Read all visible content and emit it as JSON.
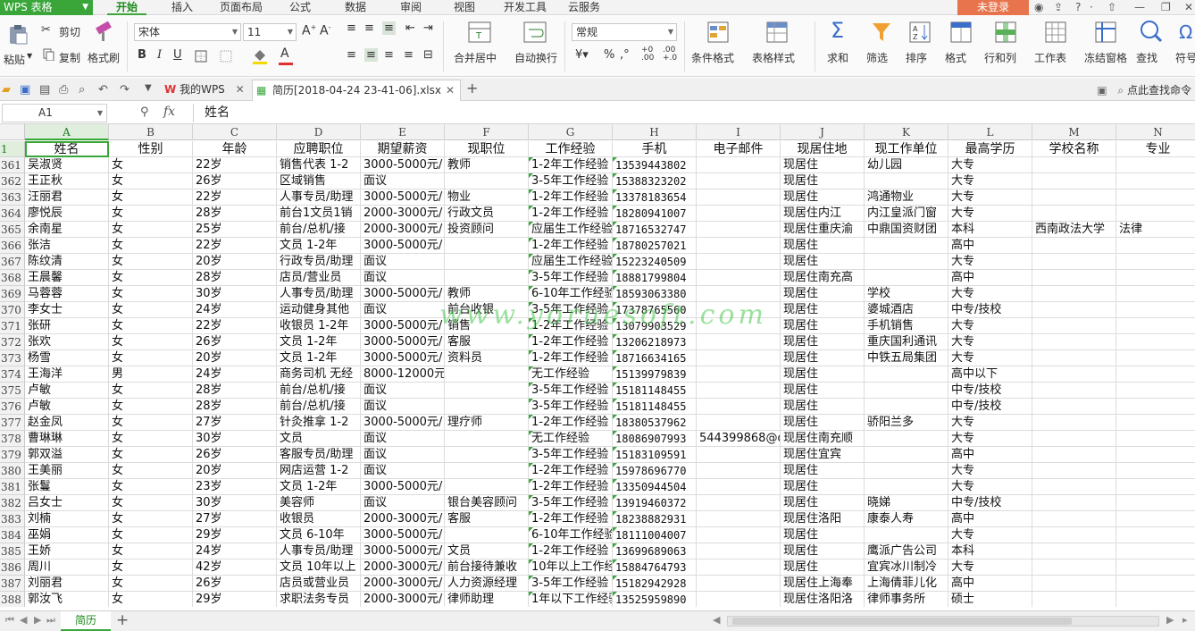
{
  "app": {
    "name": "WPS 表格"
  },
  "menu": {
    "tabs": [
      "开始",
      "插入",
      "页面布局",
      "公式",
      "数据",
      "审阅",
      "视图",
      "开发工具",
      "云服务"
    ],
    "active": "开始",
    "login": "未登录"
  },
  "ribbon": {
    "paste": "粘贴",
    "cut": "剪切",
    "copy": "复制",
    "format_painter": "格式刷",
    "font_name": "宋体",
    "font_size": "11",
    "merge_center": "合并居中",
    "wrap_text": "自动换行",
    "number_format": "常规",
    "conditional_format": "条件格式",
    "table_style": "表格样式",
    "sum": "求和",
    "filter": "筛选",
    "sort": "排序",
    "format": "格式",
    "rows_cols": "行和列",
    "worksheet": "工作表",
    "freeze": "冻结窗格",
    "find": "查找",
    "symbol": "符号",
    "accent": "#3aa63a"
  },
  "doc_tabs": {
    "home": "我的WPS",
    "document": "简历[2018-04-24 23-41-06].xlsx",
    "find_command": "点此查找命令"
  },
  "formula_bar": {
    "name_box": "A1",
    "fx": "fx",
    "content": "姓名"
  },
  "grid": {
    "columns": [
      "A",
      "B",
      "C",
      "D",
      "E",
      "F",
      "G",
      "H",
      "I",
      "J",
      "K",
      "L",
      "M",
      "N"
    ],
    "header_row_number": "1",
    "headers": [
      "姓名",
      "性别",
      "年龄",
      "应聘职位",
      "期望薪资",
      "现职位",
      "工作经验",
      "手机",
      "电子邮件",
      "现居住地",
      "现工作单位",
      "最高学历",
      "学校名称",
      "专业"
    ],
    "rows": [
      {
        "n": "361",
        "c": [
          "吴淑贤",
          "女",
          "22岁",
          "销售代表 1-2",
          "3000-5000元/",
          "教师",
          "1-2年工作经验",
          "13539443802",
          "",
          "现居住",
          "幼儿园",
          "大专",
          "",
          ""
        ]
      },
      {
        "n": "362",
        "c": [
          "王正秋",
          "女",
          "26岁",
          "区域销售",
          "面议",
          "",
          "3-5年工作经验",
          "15388323202",
          "",
          "现居住",
          "",
          "大专",
          "",
          ""
        ]
      },
      {
        "n": "363",
        "c": [
          "汪丽君",
          "女",
          "22岁",
          "人事专员/助理",
          "3000-5000元/",
          "物业",
          "1-2年工作经验",
          "13378183654",
          "",
          "现居住",
          "鸿通物业",
          "大专",
          "",
          ""
        ]
      },
      {
        "n": "364",
        "c": [
          "廖悦辰",
          "女",
          "28岁",
          "前台1文员1销",
          "2000-3000元/",
          "行政文员",
          "1-2年工作经验",
          "18280941007",
          "",
          "现居住内江",
          "内江皇派门窗",
          "大专",
          "",
          ""
        ]
      },
      {
        "n": "365",
        "c": [
          "余南星",
          "女",
          "25岁",
          "前台/总机/接",
          "2000-3000元/",
          "投资顾问",
          "应届生工作经验",
          "18716532747",
          "",
          "现居住重庆渝",
          "中鼎国资财团",
          "本科",
          "西南政法大学",
          "法律"
        ]
      },
      {
        "n": "366",
        "c": [
          "张洁",
          "女",
          "22岁",
          "文员 1-2年",
          "3000-5000元/",
          "",
          "1-2年工作经验",
          "18780257021",
          "",
          "现居住",
          "",
          "高中",
          "",
          ""
        ]
      },
      {
        "n": "367",
        "c": [
          "陈纹清",
          "女",
          "20岁",
          "行政专员/助理",
          "面议",
          "",
          "应届生工作经验",
          "15223240509",
          "",
          "现居住",
          "",
          "大专",
          "",
          ""
        ]
      },
      {
        "n": "368",
        "c": [
          "王晨馨",
          "女",
          "28岁",
          "店员/营业员",
          "面议",
          "",
          "3-5年工作经验",
          "18881799804",
          "",
          "现居住南充高",
          "",
          "高中",
          "",
          ""
        ]
      },
      {
        "n": "369",
        "c": [
          "马蓉蓉",
          "女",
          "30岁",
          "人事专员/助理",
          "3000-5000元/",
          "教师",
          "6-10年工作经验",
          "18593063380",
          "",
          "现居住",
          "学校",
          "大专",
          "",
          ""
        ]
      },
      {
        "n": "370",
        "c": [
          "李女士",
          "女",
          "24岁",
          "运动健身其他",
          "面议",
          "前台收银",
          "3-5年工作经验",
          "17378765560",
          "",
          "现居住",
          "婆城酒店",
          "中专/技校",
          "",
          ""
        ]
      },
      {
        "n": "371",
        "c": [
          "张研",
          "女",
          "22岁",
          "收银员 1-2年",
          "3000-5000元/",
          "销售",
          "1-2年工作经验",
          "13079903529",
          "",
          "现居住",
          "手机销售",
          "大专",
          "",
          ""
        ]
      },
      {
        "n": "372",
        "c": [
          "张欢",
          "女",
          "26岁",
          "文员 1-2年",
          "3000-5000元/",
          "客服",
          "1-2年工作经验",
          "13206218973",
          "",
          "现居住",
          "重庆国利通讯",
          "大专",
          "",
          ""
        ]
      },
      {
        "n": "373",
        "c": [
          "杨雪",
          "女",
          "20岁",
          "文员 1-2年",
          "3000-5000元/",
          "资料员",
          "1-2年工作经验",
          "18716634165",
          "",
          "现居住",
          "中铁五局集团",
          "大专",
          "",
          ""
        ]
      },
      {
        "n": "374",
        "c": [
          "王海洋",
          "男",
          "24岁",
          "商务司机 无经",
          "8000-12000元",
          "",
          "无工作经验",
          "15139979839",
          "",
          "现居住",
          "",
          "高中以下",
          "",
          ""
        ]
      },
      {
        "n": "375",
        "c": [
          "卢敏",
          "女",
          "28岁",
          "前台/总机/接",
          "面议",
          "",
          "3-5年工作经验",
          "15181148455",
          "",
          "现居住",
          "",
          "中专/技校",
          "",
          ""
        ]
      },
      {
        "n": "376",
        "c": [
          "卢敏",
          "女",
          "28岁",
          "前台/总机/接",
          "面议",
          "",
          "3-5年工作经验",
          "15181148455",
          "",
          "现居住",
          "",
          "中专/技校",
          "",
          ""
        ]
      },
      {
        "n": "377",
        "c": [
          "赵金凤",
          "女",
          "27岁",
          "针灸推拿 1-2",
          "3000-5000元/",
          "理疗师",
          "1-2年工作经验",
          "18380537962",
          "",
          "现居住",
          "骄阳兰多",
          "大专",
          "",
          ""
        ]
      },
      {
        "n": "378",
        "c": [
          "曹琳琳",
          "女",
          "30岁",
          "文员",
          "面议",
          "",
          "无工作经验",
          "18086907993",
          "544399868@qq",
          "现居住南充顺",
          "",
          "大专",
          "",
          ""
        ]
      },
      {
        "n": "379",
        "c": [
          "郭双溢",
          "女",
          "26岁",
          "客服专员/助理",
          "面议",
          "",
          "3-5年工作经验",
          "15183109591",
          "",
          "现居住宜宾",
          "",
          "高中",
          "",
          ""
        ]
      },
      {
        "n": "380",
        "c": [
          "王美丽",
          "女",
          "20岁",
          "网店运营 1-2",
          "面议",
          "",
          "1-2年工作经验",
          "15978696770",
          "",
          "现居住",
          "",
          "大专",
          "",
          ""
        ]
      },
      {
        "n": "381",
        "c": [
          "张鬘",
          "女",
          "23岁",
          "文员 1-2年",
          "3000-5000元/",
          "",
          "1-2年工作经验",
          "13350944504",
          "",
          "现居住",
          "",
          "大专",
          "",
          ""
        ]
      },
      {
        "n": "382",
        "c": [
          "吕女士",
          "女",
          "30岁",
          "美容师",
          "面议",
          "银台美容顾问",
          "3-5年工作经验",
          "13919460372",
          "",
          "现居住",
          "晓娣",
          "中专/技校",
          "",
          ""
        ]
      },
      {
        "n": "383",
        "c": [
          "刘楠",
          "女",
          "27岁",
          "收银员",
          "2000-3000元/",
          "客服",
          "1-2年工作经验",
          "18238882931",
          "",
          "现居住洛阳",
          "康泰人寿",
          "高中",
          "",
          ""
        ]
      },
      {
        "n": "384",
        "c": [
          "巫娟",
          "女",
          "29岁",
          "文员 6-10年",
          "3000-5000元/",
          "",
          "6-10年工作经验",
          "18111004007",
          "",
          "现居住",
          "",
          "大专",
          "",
          ""
        ]
      },
      {
        "n": "385",
        "c": [
          "王娇",
          "女",
          "24岁",
          "人事专员/助理",
          "3000-5000元/",
          "文员",
          "1-2年工作经验",
          "13699689063",
          "",
          "现居住",
          "鹰派广告公司",
          "本科",
          "",
          ""
        ]
      },
      {
        "n": "386",
        "c": [
          "周川",
          "女",
          "42岁",
          "文员 10年以上",
          "2000-3000元/",
          "前台接待兼收",
          "10年以上工作经验",
          "15884764793",
          "",
          "现居住",
          "宜宾冰川制冷",
          "大专",
          "",
          ""
        ]
      },
      {
        "n": "387",
        "c": [
          "刘丽君",
          "女",
          "26岁",
          "店员或营业员",
          "2000-3000元/",
          "人力资源经理",
          "3-5年工作经验",
          "15182942928",
          "",
          "现居住上海奉",
          "上海倩菲儿化",
          "高中",
          "",
          ""
        ]
      },
      {
        "n": "388",
        "c": [
          "郭汝飞",
          "女",
          "29岁",
          "求职法务专员",
          "2000-3000元/",
          "律师助理",
          "1年以下工作经验",
          "13525959890",
          "",
          "现居住洛阳洛",
          "律师事务所",
          "硕士",
          "",
          ""
        ]
      }
    ]
  },
  "watermark": "www.yoruesoft.com",
  "sheet_tabs": {
    "active": "简历"
  }
}
